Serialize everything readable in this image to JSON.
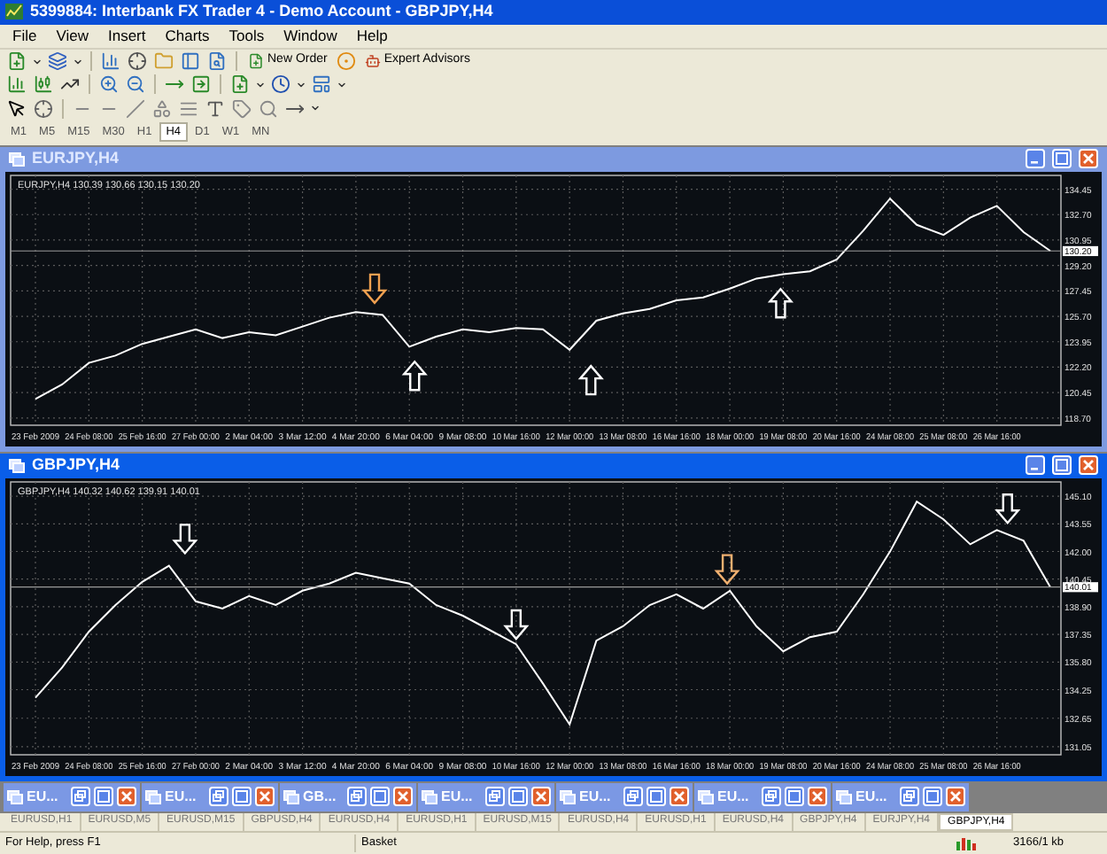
{
  "window": {
    "title": "5399884: Interbank FX Trader 4 - Demo Account - GBPJPY,H4"
  },
  "menu": [
    "File",
    "View",
    "Insert",
    "Charts",
    "Tools",
    "Window",
    "Help"
  ],
  "toolbar": {
    "buttons": [
      {
        "label": "New Order"
      },
      {
        "label": "Expert Advisors"
      }
    ]
  },
  "timeframes": [
    {
      "label": "M1",
      "selected": false
    },
    {
      "label": "M5",
      "selected": false
    },
    {
      "label": "M15",
      "selected": false
    },
    {
      "label": "M30",
      "selected": false
    },
    {
      "label": "H1",
      "selected": false
    },
    {
      "label": "H4",
      "selected": true
    },
    {
      "label": "D1",
      "selected": false
    },
    {
      "label": "W1",
      "selected": false
    },
    {
      "label": "MN",
      "selected": false
    }
  ],
  "chart_windows": [
    {
      "title": "EURJPY,H4",
      "active": false,
      "markers": [
        {
          "kind": "arrow_down",
          "color": "#f0a050"
        },
        {
          "kind": "arrow_up",
          "color": "#ffffff"
        },
        {
          "kind": "arrow_up",
          "color": "#ffffff"
        },
        {
          "kind": "arrow_up",
          "color": "#ffffff"
        }
      ],
      "chart_data": {
        "type": "line",
        "title": "130.39 130.66 130.15 130.20",
        "grid": true,
        "ylim": [
          118.2,
          135.4
        ],
        "categories": [
          "23 Feb 2009",
          null,
          "24 Feb 08:00",
          null,
          "25 Feb 16:00",
          null,
          "27 Feb 00:00",
          null,
          "2 Mar 04:00",
          null,
          "3 Mar 12:00",
          null,
          "4 Mar 20:00",
          null,
          "6 Mar 04:00",
          null,
          "9 Mar 08:00",
          null,
          "10 Mar 16:00",
          null,
          "12 Mar 00:00",
          null,
          "13 Mar 08:00",
          null,
          "16 Mar 16:00",
          null,
          "18 Mar 00:00",
          null,
          "19 Mar 08:00",
          null,
          "20 Mar 16:00",
          null,
          "24 Mar 08:00",
          null,
          "25 Mar 08:00",
          null,
          "26 Mar 16:00",
          null,
          null
        ],
        "yticks": [
          {
            "value": 134.45,
            "label": "134.45"
          },
          {
            "value": 132.7,
            "label": "132.70"
          },
          {
            "value": 130.95,
            "label": "130.95"
          },
          {
            "value": 129.2,
            "label": "129.20"
          },
          {
            "value": 127.45,
            "label": "127.45"
          },
          {
            "value": 125.7,
            "label": "125.70"
          },
          {
            "value": 123.95,
            "label": "123.95"
          },
          {
            "value": 122.2,
            "label": "122.20"
          },
          {
            "value": 120.45,
            "label": "120.45"
          },
          {
            "value": 118.7,
            "label": "118.70"
          }
        ],
        "series": [
          {
            "name": "EURJPY,H4",
            "color": "#ffffff",
            "values": [
              120.0,
              121.0,
              122.5,
              123.0,
              123.8,
              124.3,
              124.8,
              124.2,
              124.6,
              124.4,
              125.0,
              125.6,
              126.0,
              125.8,
              123.6,
              124.3,
              124.8,
              124.6,
              124.9,
              124.8,
              123.4,
              125.4,
              125.9,
              126.2,
              126.8,
              127.0,
              127.6,
              128.3,
              128.6,
              128.8,
              129.6,
              131.6,
              133.8,
              132.0,
              131.3,
              132.5,
              133.3,
              131.5,
              130.2
            ]
          }
        ],
        "ref_lines": [
          {
            "axis": "y",
            "value": 130.2,
            "label": "130.20",
            "color": "#9a9a9a"
          }
        ]
      }
    },
    {
      "title": "GBPJPY,H4",
      "active": true,
      "markers": [
        {
          "kind": "arrow_down",
          "color": "#ffffff"
        },
        {
          "kind": "arrow_down",
          "color": "#ffffff"
        },
        {
          "kind": "arrow_down",
          "color": "#f0b070"
        },
        {
          "kind": "arrow_down",
          "color": "#ffffff"
        }
      ],
      "chart_data": {
        "type": "line",
        "title": "140.32 140.62 139.91 140.01",
        "grid": true,
        "ylim": [
          130.6,
          145.9
        ],
        "categories": [
          "23 Feb 2009",
          null,
          "24 Feb 08:00",
          null,
          "25 Feb 16:00",
          null,
          "27 Feb 00:00",
          null,
          "2 Mar 04:00",
          null,
          "3 Mar 12:00",
          null,
          "4 Mar 20:00",
          null,
          "6 Mar 04:00",
          null,
          "9 Mar 08:00",
          null,
          "10 Mar 16:00",
          null,
          "12 Mar 00:00",
          null,
          "13 Mar 08:00",
          null,
          "16 Mar 16:00",
          null,
          "18 Mar 00:00",
          null,
          "19 Mar 08:00",
          null,
          "20 Mar 16:00",
          null,
          "24 Mar 08:00",
          null,
          "25 Mar 08:00",
          null,
          "26 Mar 16:00",
          null,
          null
        ],
        "yticks": [
          {
            "value": 145.1,
            "label": "145.10"
          },
          {
            "value": 143.55,
            "label": "143.55"
          },
          {
            "value": 142.0,
            "label": "142.00"
          },
          {
            "value": 140.45,
            "label": "140.45"
          },
          {
            "value": 138.9,
            "label": "138.90"
          },
          {
            "value": 137.35,
            "label": "137.35"
          },
          {
            "value": 135.8,
            "label": "135.80"
          },
          {
            "value": 134.25,
            "label": "134.25"
          },
          {
            "value": 132.65,
            "label": "132.65"
          },
          {
            "value": 131.05,
            "label": "131.05"
          }
        ],
        "series": [
          {
            "name": "GBPJPY,H4",
            "color": "#ffffff",
            "values": [
              133.8,
              135.5,
              137.5,
              139.0,
              140.3,
              141.2,
              139.2,
              138.8,
              139.5,
              139.0,
              139.8,
              140.2,
              140.8,
              140.5,
              140.2,
              139.0,
              138.4,
              137.6,
              136.8,
              134.6,
              132.3,
              137.0,
              137.8,
              139.0,
              139.6,
              138.8,
              139.8,
              137.8,
              136.4,
              137.2,
              137.5,
              139.6,
              142.0,
              144.8,
              143.8,
              142.4,
              143.2,
              142.6,
              140.0
            ]
          }
        ],
        "ref_lines": [
          {
            "axis": "y",
            "value": 140.01,
            "label": "140.01",
            "color": "#9a9a9a"
          }
        ]
      }
    }
  ],
  "minimized_windows": [
    {
      "title": "EU..."
    },
    {
      "title": "EU..."
    },
    {
      "title": "GB..."
    },
    {
      "title": "EU..."
    },
    {
      "title": "EU..."
    },
    {
      "title": "EU..."
    },
    {
      "title": "EU..."
    }
  ],
  "chart_tabs": [
    {
      "label": "EURUSD,H1",
      "selected": false
    },
    {
      "label": "EURUSD,M5",
      "selected": false
    },
    {
      "label": "EURUSD,M15",
      "selected": false
    },
    {
      "label": "GBPUSD,H4",
      "selected": false
    },
    {
      "label": "EURUSD,H4",
      "selected": false
    },
    {
      "label": "EURUSD,H1",
      "selected": false
    },
    {
      "label": "EURUSD,M15",
      "selected": false
    },
    {
      "label": "EURUSD,H4",
      "selected": false
    },
    {
      "label": "EURUSD,H1",
      "selected": false
    },
    {
      "label": "EURUSD,H4",
      "selected": false
    },
    {
      "label": "GBPJPY,H4",
      "selected": false
    },
    {
      "label": "EURJPY,H4",
      "selected": false
    },
    {
      "label": "GBPJPY,H4",
      "selected": true
    }
  ],
  "status_bar": {
    "help": "For Help, press F1",
    "profile": "Basket",
    "traffic": "3166/1 kb"
  }
}
